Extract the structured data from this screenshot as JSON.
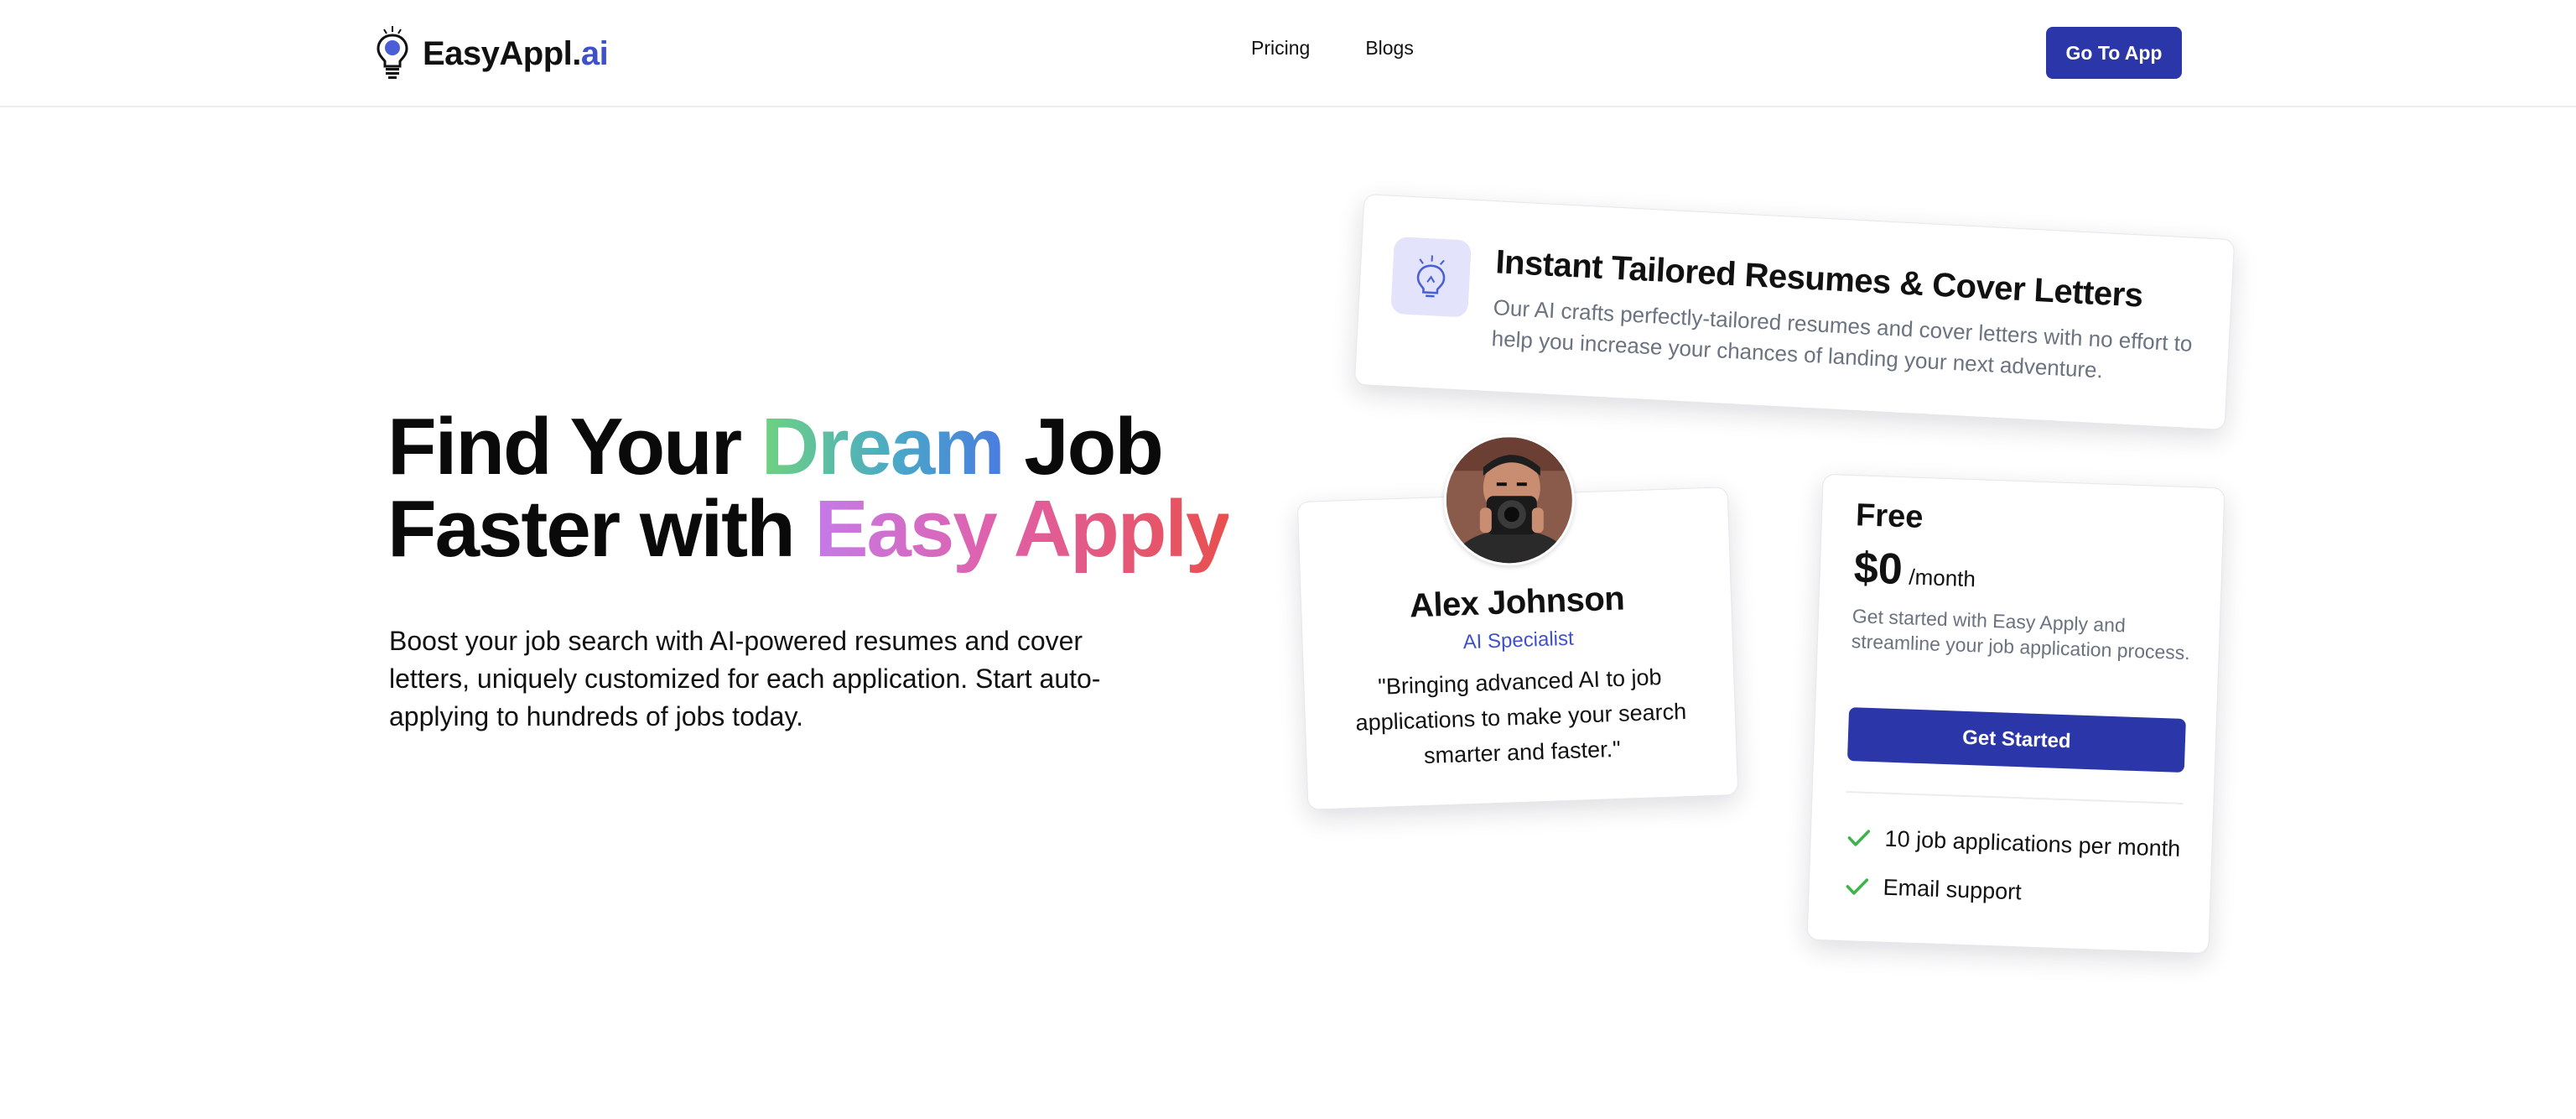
{
  "header": {
    "brand_main": "EasyAppl.",
    "brand_accent": "ai",
    "nav": [
      {
        "label": "Pricing"
      },
      {
        "label": "Blogs"
      }
    ],
    "cta_label": "Go To App"
  },
  "hero": {
    "title_part1": "Find Your ",
    "title_highlight1": "Dream",
    "title_part2": " Job",
    "title_part3": "Faster with ",
    "title_highlight2": "Easy Apply",
    "subtitle": "Boost your job search with AI-powered resumes and cover letters, uniquely customized for each application. Start auto-applying to hundreds of jobs today."
  },
  "feature_card": {
    "icon": "lightbulb-icon",
    "title": "Instant Tailored Resumes & Cover Letters",
    "description": "Our AI crafts perfectly-tailored resumes and cover letters with no effort to help you increase your chances of landing your next adventure."
  },
  "profile_card": {
    "name": "Alex Johnson",
    "role": "AI Specialist",
    "quote": "\"Bringing advanced AI to job applications to make your search smarter and faster.\""
  },
  "pricing_card": {
    "plan": "Free",
    "price": "$0",
    "period": "/month",
    "description": "Get started with Easy Apply and streamline your job application process.",
    "cta_label": "Get Started",
    "features": [
      {
        "label": "10 job applications per month"
      },
      {
        "label": "Email support"
      }
    ]
  },
  "colors": {
    "primary": "#2b37a8",
    "accent": "#3f51c9",
    "check": "#3bb54a"
  }
}
